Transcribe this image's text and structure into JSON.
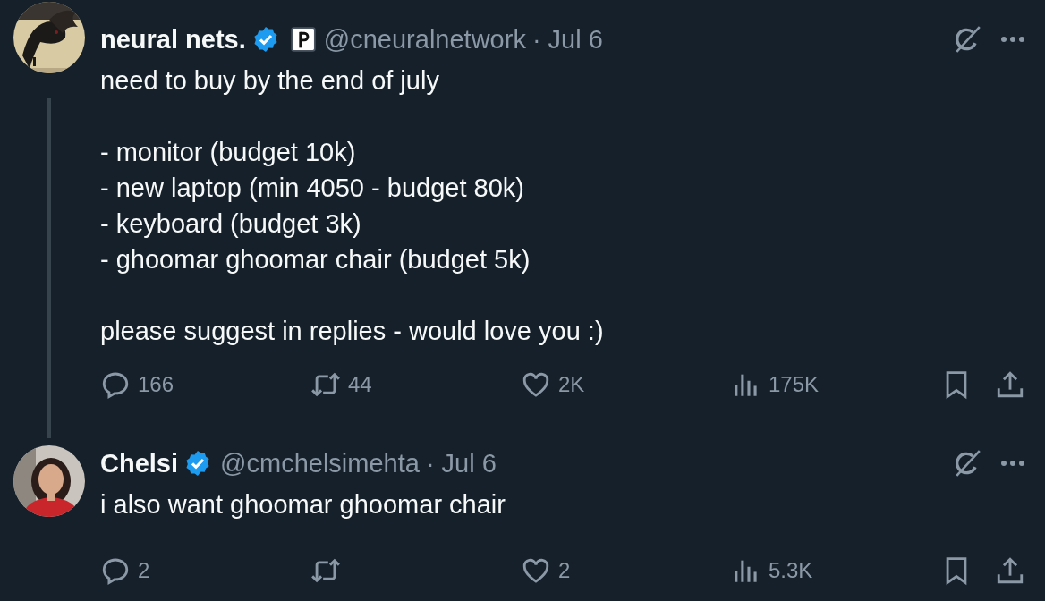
{
  "tweets": [
    {
      "name": "neural nets.",
      "verified": true,
      "affiliate_badge": true,
      "handle": "@cneuralnetwork",
      "time": "· Jul 6",
      "thread_line": true,
      "text": "need to buy by the end of july\n\n- monitor (budget 10k)\n- new laptop (min 4050 - budget 80k)\n- keyboard (budget 3k)\n- ghoomar ghoomar chair (budget 5k)\n\nplease suggest in replies - would love you :)",
      "actions": [
        {
          "kind": "reply",
          "count": "166"
        },
        {
          "kind": "repost",
          "count": "44"
        },
        {
          "kind": "like",
          "count": "2K"
        },
        {
          "kind": "views",
          "count": "175K"
        },
        {
          "kind": "bookmark"
        },
        {
          "kind": "share"
        }
      ]
    },
    {
      "name": "Chelsi",
      "verified": true,
      "affiliate_badge": false,
      "handle": "@cmchelsimehta",
      "time": "· Jul 6",
      "thread_line": false,
      "text": "i also want ghoomar ghoomar chair",
      "actions": [
        {
          "kind": "reply",
          "count": "2"
        },
        {
          "kind": "repost"
        },
        {
          "kind": "like",
          "count": "2"
        },
        {
          "kind": "views",
          "count": "5.3K"
        },
        {
          "kind": "bookmark"
        },
        {
          "kind": "share"
        }
      ]
    }
  ]
}
